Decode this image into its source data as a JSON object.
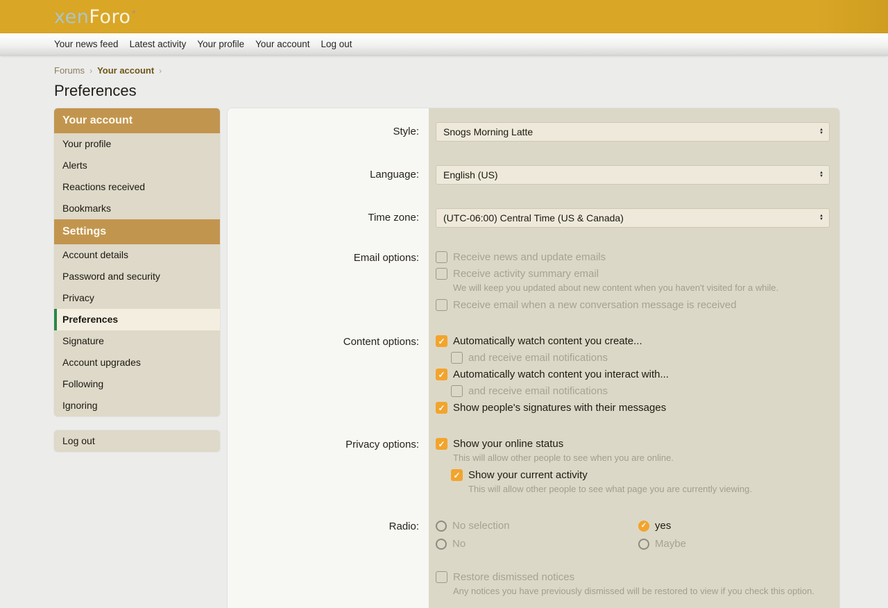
{
  "header": {
    "logo_part1": "xen",
    "logo_part2": "Foro"
  },
  "nav": {
    "items": [
      "Your news feed",
      "Latest activity",
      "Your profile",
      "Your account",
      "Log out"
    ]
  },
  "breadcrumb": {
    "forums": "Forums",
    "current": "Your account",
    "separator": "›"
  },
  "page_title": "Preferences",
  "sidebar": {
    "account_header": "Your account",
    "account_items": [
      "Your profile",
      "Alerts",
      "Reactions received",
      "Bookmarks"
    ],
    "settings_header": "Settings",
    "settings_items": [
      "Account details",
      "Password and security",
      "Privacy",
      "Preferences",
      "Signature",
      "Account upgrades",
      "Following",
      "Ignoring"
    ],
    "selected_item": "Preferences",
    "logout_label": "Log out"
  },
  "form": {
    "style": {
      "label": "Style:",
      "value": "Snogs Morning Latte"
    },
    "language": {
      "label": "Language:",
      "value": "English (US)"
    },
    "timezone": {
      "label": "Time zone:",
      "value": "(UTC-06:00) Central Time (US & Canada)"
    },
    "email_options": {
      "label": "Email options:",
      "news": {
        "label": "Receive news and update emails",
        "checked": false
      },
      "summary": {
        "label": "Receive activity summary email",
        "checked": false,
        "hint": "We will keep you updated about new content when you haven't visited for a while."
      },
      "conversation": {
        "label": "Receive email when a new conversation message is received",
        "checked": false
      }
    },
    "content_options": {
      "label": "Content options:",
      "watch_create": {
        "label": "Automatically watch content you create...",
        "checked": true
      },
      "watch_create_email": {
        "label": "and receive email notifications",
        "checked": false
      },
      "watch_interact": {
        "label": "Automatically watch content you interact with...",
        "checked": true
      },
      "watch_interact_email": {
        "label": "and receive email notifications",
        "checked": false
      },
      "signatures": {
        "label": "Show people's signatures with their messages",
        "checked": true
      }
    },
    "privacy_options": {
      "label": "Privacy options:",
      "online_status": {
        "label": "Show your online status",
        "checked": true,
        "hint": "This will allow other people to see when you are online."
      },
      "current_activity": {
        "label": "Show your current activity",
        "checked": true,
        "hint": "This will allow other people to see what page you are currently viewing."
      }
    },
    "radio": {
      "label": "Radio:",
      "options": [
        {
          "label": "No selection",
          "selected": false
        },
        {
          "label": "yes",
          "selected": true
        },
        {
          "label": "No",
          "selected": false
        },
        {
          "label": "Maybe",
          "selected": false
        }
      ]
    },
    "notices": {
      "restore": {
        "label": "Restore dismissed notices",
        "checked": false,
        "hint": "Any notices you have previously dismissed will be restored to view if you check this option."
      }
    }
  },
  "colors": {
    "accent_orange": "#f2a42d",
    "header_gold": "#d9a626",
    "sidebar_header_gold": "#c2954f",
    "selected_green": "#2c8647",
    "panel_control_bg": "#dcd8c7"
  }
}
